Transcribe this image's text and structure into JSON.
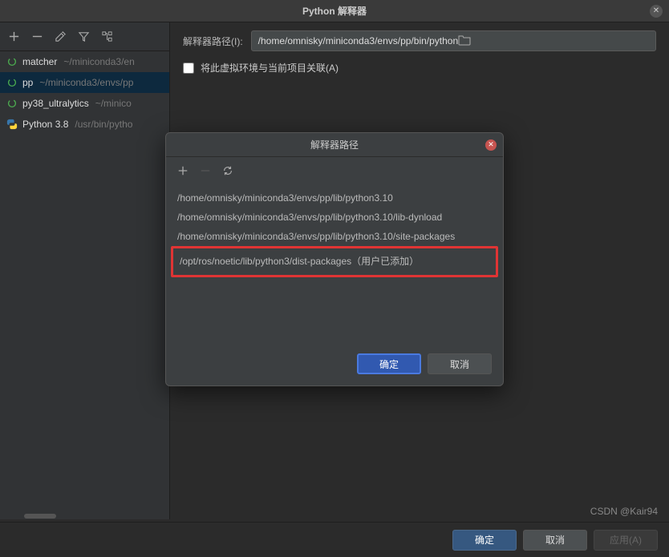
{
  "window": {
    "title": "Python 解释器"
  },
  "sidebar": {
    "items": [
      {
        "name": "matcher",
        "path": "~/miniconda3/en",
        "type": "conda"
      },
      {
        "name": "pp",
        "path": "~/miniconda3/envs/pp",
        "type": "conda",
        "selected": true
      },
      {
        "name": "py38_ultralytics",
        "path": "~/minico",
        "type": "conda"
      },
      {
        "name": "Python 3.8",
        "path": "/usr/bin/pytho",
        "type": "python"
      }
    ]
  },
  "content": {
    "path_label": "解释器路径(I):",
    "path_value": "/home/omnisky/miniconda3/envs/pp/bin/python",
    "checkbox_label": "将此虚拟环境与当前项目关联(A)"
  },
  "modal": {
    "title": "解释器路径",
    "paths": [
      "/home/omnisky/miniconda3/envs/pp/lib/python3.10",
      "/home/omnisky/miniconda3/envs/pp/lib/python3.10/lib-dynload",
      "/home/omnisky/miniconda3/envs/pp/lib/python3.10/site-packages"
    ],
    "highlighted_path": "/opt/ros/noetic/lib/python3/dist-packages（用户已添加）",
    "ok": "确定",
    "cancel": "取消"
  },
  "buttons": {
    "ok": "确定",
    "cancel": "取消",
    "apply": "应用(A)"
  },
  "watermark": "CSDN @Kair94"
}
